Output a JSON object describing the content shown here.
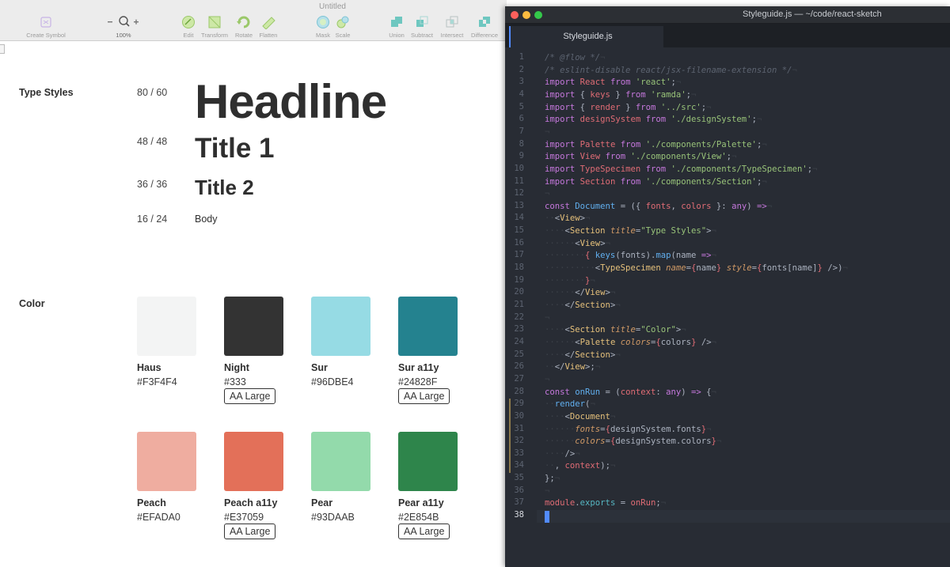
{
  "sketch": {
    "window_title": "Untitled",
    "toolbar": [
      {
        "label": "Create Symbol",
        "icon": "create-symbol-icon"
      },
      {
        "label": "100%",
        "icon": "zoom-icon"
      },
      {
        "label": "Edit",
        "icon": "edit-icon"
      },
      {
        "label": "Transform",
        "icon": "transform-icon"
      },
      {
        "label": "Rotate",
        "icon": "rotate-icon"
      },
      {
        "label": "Flatten",
        "icon": "flatten-icon"
      },
      {
        "label": "Mask",
        "icon": "mask-icon"
      },
      {
        "label": "Scale",
        "icon": "scale-icon"
      },
      {
        "label": "Union",
        "icon": "union-icon"
      },
      {
        "label": "Subtract",
        "icon": "subtract-icon"
      },
      {
        "label": "Intersect",
        "icon": "intersect-icon"
      },
      {
        "label": "Difference",
        "icon": "difference-icon"
      }
    ],
    "type_styles": {
      "label": "Type Styles",
      "items": [
        {
          "size": "80 / 60",
          "sample": "Headline"
        },
        {
          "size": "48 / 48",
          "sample": "Title 1"
        },
        {
          "size": "36 / 36",
          "sample": "Title 2"
        },
        {
          "size": "16 / 24",
          "sample": "Body"
        }
      ]
    },
    "color": {
      "label": "Color",
      "swatches": [
        {
          "name": "Haus",
          "hex": "#F3F4F4",
          "color": "#F3F4F4",
          "badge": ""
        },
        {
          "name": "Night",
          "hex": "#333",
          "color": "#333333",
          "badge": "AA Large"
        },
        {
          "name": "Sur",
          "hex": "#96DBE4",
          "color": "#96DBE4",
          "badge": ""
        },
        {
          "name": "Sur a11y",
          "hex": "#24828F",
          "color": "#24828F",
          "badge": "AA Large"
        },
        {
          "name": "Peach",
          "hex": "#EFADA0",
          "color": "#EFADA0",
          "badge": ""
        },
        {
          "name": "Peach a11y",
          "hex": "#E37059",
          "color": "#E37059",
          "badge": "AA Large"
        },
        {
          "name": "Pear",
          "hex": "#93DAAB",
          "color": "#93DAAB",
          "badge": ""
        },
        {
          "name": "Pear a11y",
          "hex": "#2E854B",
          "color": "#2E854B",
          "badge": "AA Large"
        }
      ]
    }
  },
  "editor": {
    "window_title": "Styleguide.js — ~/code/react-sketch",
    "tab_label": "Styleguide.js",
    "line_numbers": [
      "1",
      "2",
      "3",
      "4",
      "5",
      "6",
      "7",
      "8",
      "9",
      "10",
      "11",
      "12",
      "13",
      "14",
      "15",
      "16",
      "17",
      "18",
      "19",
      "20",
      "21",
      "22",
      "23",
      "24",
      "25",
      "26",
      "27",
      "28",
      "29",
      "30",
      "31",
      "32",
      "33",
      "34",
      "35",
      "36",
      "37",
      "38"
    ],
    "active_line": 38,
    "code": [
      [
        [
          "/* @flow */",
          "c"
        ],
        [
          "¬",
          "ws"
        ]
      ],
      [
        [
          "/* eslint-disable react/jsx-filename-extension */",
          "c"
        ],
        [
          "¬",
          "ws"
        ]
      ],
      [
        [
          "import",
          "k"
        ],
        [
          " ",
          ""
        ],
        [
          "React",
          "v"
        ],
        [
          " ",
          ""
        ],
        [
          "from",
          "k"
        ],
        [
          " ",
          ""
        ],
        [
          "'react'",
          "s"
        ],
        [
          ";",
          "p"
        ],
        [
          "¬",
          "ws"
        ]
      ],
      [
        [
          "import",
          "k"
        ],
        [
          " { ",
          "p"
        ],
        [
          "keys",
          "v"
        ],
        [
          " } ",
          "p"
        ],
        [
          "from",
          "k"
        ],
        [
          " ",
          ""
        ],
        [
          "'ramda'",
          "s"
        ],
        [
          ";",
          "p"
        ],
        [
          "¬",
          "ws"
        ]
      ],
      [
        [
          "import",
          "k"
        ],
        [
          " { ",
          "p"
        ],
        [
          "render",
          "v"
        ],
        [
          " } ",
          "p"
        ],
        [
          "from",
          "k"
        ],
        [
          " ",
          ""
        ],
        [
          "'../src'",
          "s"
        ],
        [
          ";",
          "p"
        ],
        [
          "¬",
          "ws"
        ]
      ],
      [
        [
          "import",
          "k"
        ],
        [
          " ",
          ""
        ],
        [
          "designSystem",
          "v"
        ],
        [
          " ",
          ""
        ],
        [
          "from",
          "k"
        ],
        [
          " ",
          ""
        ],
        [
          "'./designSystem'",
          "s"
        ],
        [
          ";",
          "p"
        ],
        [
          "¬",
          "ws"
        ]
      ],
      [
        [
          "¬",
          "ws"
        ]
      ],
      [
        [
          "import",
          "k"
        ],
        [
          " ",
          ""
        ],
        [
          "Palette",
          "v"
        ],
        [
          " ",
          ""
        ],
        [
          "from",
          "k"
        ],
        [
          " ",
          ""
        ],
        [
          "'./components/Palette'",
          "s"
        ],
        [
          ";",
          "p"
        ],
        [
          "¬",
          "ws"
        ]
      ],
      [
        [
          "import",
          "k"
        ],
        [
          " ",
          ""
        ],
        [
          "View",
          "v"
        ],
        [
          " ",
          ""
        ],
        [
          "from",
          "k"
        ],
        [
          " ",
          ""
        ],
        [
          "'./components/View'",
          "s"
        ],
        [
          ";",
          "p"
        ],
        [
          "¬",
          "ws"
        ]
      ],
      [
        [
          "import",
          "k"
        ],
        [
          " ",
          ""
        ],
        [
          "TypeSpecimen",
          "v"
        ],
        [
          " ",
          ""
        ],
        [
          "from",
          "k"
        ],
        [
          " ",
          ""
        ],
        [
          "'./components/TypeSpecimen'",
          "s"
        ],
        [
          ";",
          "p"
        ],
        [
          "¬",
          "ws"
        ]
      ],
      [
        [
          "import",
          "k"
        ],
        [
          " ",
          ""
        ],
        [
          "Section",
          "v"
        ],
        [
          " ",
          ""
        ],
        [
          "from",
          "k"
        ],
        [
          " ",
          ""
        ],
        [
          "'./components/Section'",
          "s"
        ],
        [
          ";",
          "p"
        ],
        [
          "¬",
          "ws"
        ]
      ],
      [
        [
          "¬",
          "ws"
        ]
      ],
      [
        [
          "const",
          "k"
        ],
        [
          " ",
          ""
        ],
        [
          "Document",
          "f"
        ],
        [
          " = (",
          "p"
        ],
        [
          "{ ",
          "p"
        ],
        [
          "fonts",
          "v"
        ],
        [
          ", ",
          "p"
        ],
        [
          "colors",
          "v"
        ],
        [
          " }",
          "p"
        ],
        [
          ": ",
          "p"
        ],
        [
          "any",
          "k"
        ],
        [
          ") ",
          "p"
        ],
        [
          "=>",
          "k"
        ],
        [
          "¬",
          "ws"
        ]
      ],
      [
        [
          "··",
          "ws"
        ],
        [
          "<",
          "p"
        ],
        [
          "View",
          "tag"
        ],
        [
          ">",
          "p"
        ],
        [
          "¬",
          "ws"
        ]
      ],
      [
        [
          "····",
          "ws"
        ],
        [
          "<",
          "p"
        ],
        [
          "Section",
          "tag"
        ],
        [
          " ",
          ""
        ],
        [
          "title",
          "a"
        ],
        [
          "=",
          "p"
        ],
        [
          "\"Type Styles\"",
          "s"
        ],
        [
          ">",
          "p"
        ],
        [
          "¬",
          "ws"
        ]
      ],
      [
        [
          "······",
          "ws"
        ],
        [
          "<",
          "p"
        ],
        [
          "View",
          "tag"
        ],
        [
          ">",
          "p"
        ],
        [
          "¬",
          "ws"
        ]
      ],
      [
        [
          "········",
          "ws"
        ],
        [
          "{ ",
          "v"
        ],
        [
          "keys",
          "f"
        ],
        [
          "(fonts).",
          "p"
        ],
        [
          "map",
          "f"
        ],
        [
          "(name ",
          "p"
        ],
        [
          "=>",
          "k"
        ],
        [
          "¬",
          "ws"
        ]
      ],
      [
        [
          "··········",
          "ws"
        ],
        [
          "<",
          "p"
        ],
        [
          "TypeSpecimen",
          "tag"
        ],
        [
          " ",
          ""
        ],
        [
          "name",
          "a"
        ],
        [
          "=",
          "p"
        ],
        [
          "{",
          "v"
        ],
        [
          "name",
          "p"
        ],
        [
          "}",
          "v"
        ],
        [
          " ",
          ""
        ],
        [
          "style",
          "a"
        ],
        [
          "=",
          "p"
        ],
        [
          "{",
          "v"
        ],
        [
          "fonts[name]",
          "p"
        ],
        [
          "}",
          "v"
        ],
        [
          " />)",
          "p"
        ],
        [
          "¬",
          "ws"
        ]
      ],
      [
        [
          "········",
          "ws"
        ],
        [
          "}",
          "v"
        ],
        [
          "¬",
          "ws"
        ]
      ],
      [
        [
          "······",
          "ws"
        ],
        [
          "</",
          "p"
        ],
        [
          "View",
          "tag"
        ],
        [
          ">",
          "p"
        ],
        [
          "¬",
          "ws"
        ]
      ],
      [
        [
          "····",
          "ws"
        ],
        [
          "</",
          "p"
        ],
        [
          "Section",
          "tag"
        ],
        [
          ">",
          "p"
        ],
        [
          "¬",
          "ws"
        ]
      ],
      [
        [
          "¬",
          "ws"
        ]
      ],
      [
        [
          "····",
          "ws"
        ],
        [
          "<",
          "p"
        ],
        [
          "Section",
          "tag"
        ],
        [
          " ",
          ""
        ],
        [
          "title",
          "a"
        ],
        [
          "=",
          "p"
        ],
        [
          "\"Color\"",
          "s"
        ],
        [
          ">",
          "p"
        ],
        [
          "¬",
          "ws"
        ]
      ],
      [
        [
          "······",
          "ws"
        ],
        [
          "<",
          "p"
        ],
        [
          "Palette",
          "tag"
        ],
        [
          " ",
          ""
        ],
        [
          "colors",
          "a"
        ],
        [
          "=",
          "p"
        ],
        [
          "{",
          "v"
        ],
        [
          "colors",
          "p"
        ],
        [
          "}",
          "v"
        ],
        [
          " />",
          "p"
        ],
        [
          "¬",
          "ws"
        ]
      ],
      [
        [
          "····",
          "ws"
        ],
        [
          "</",
          "p"
        ],
        [
          "Section",
          "tag"
        ],
        [
          ">",
          "p"
        ],
        [
          "¬",
          "ws"
        ]
      ],
      [
        [
          "··",
          "ws"
        ],
        [
          "</",
          "p"
        ],
        [
          "View",
          "tag"
        ],
        [
          ">;",
          "p"
        ],
        [
          "¬",
          "ws"
        ]
      ],
      [
        [
          "¬",
          "ws"
        ]
      ],
      [
        [
          "const",
          "k"
        ],
        [
          " ",
          ""
        ],
        [
          "onRun",
          "f"
        ],
        [
          " = (",
          "p"
        ],
        [
          "context",
          "v"
        ],
        [
          ": ",
          "p"
        ],
        [
          "any",
          "k"
        ],
        [
          ") ",
          "p"
        ],
        [
          "=>",
          "k"
        ],
        [
          " {",
          "p"
        ],
        [
          "¬",
          "ws"
        ]
      ],
      [
        [
          "··",
          "ws"
        ],
        [
          "render",
          "f"
        ],
        [
          "(",
          "p"
        ],
        [
          "¬",
          "ws"
        ]
      ],
      [
        [
          "····",
          "ws"
        ],
        [
          "<",
          "p"
        ],
        [
          "Document",
          "tag"
        ],
        [
          "¬",
          "ws"
        ]
      ],
      [
        [
          "······",
          "ws"
        ],
        [
          "fonts",
          "a"
        ],
        [
          "=",
          "p"
        ],
        [
          "{",
          "v"
        ],
        [
          "designSystem.fonts",
          "p"
        ],
        [
          "}",
          "v"
        ],
        [
          "¬",
          "ws"
        ]
      ],
      [
        [
          "······",
          "ws"
        ],
        [
          "colors",
          "a"
        ],
        [
          "=",
          "p"
        ],
        [
          "{",
          "v"
        ],
        [
          "designSystem.colors",
          "p"
        ],
        [
          "}",
          "v"
        ],
        [
          "¬",
          "ws"
        ]
      ],
      [
        [
          "····",
          "ws"
        ],
        [
          "/>",
          "p"
        ],
        [
          "¬",
          "ws"
        ]
      ],
      [
        [
          "··",
          "ws"
        ],
        [
          ", ",
          "p"
        ],
        [
          "context",
          "v"
        ],
        [
          ");",
          "p"
        ],
        [
          "¬",
          "ws"
        ]
      ],
      [
        [
          "};",
          "p"
        ],
        [
          "¬",
          "ws"
        ]
      ],
      [
        [
          "¬",
          "ws"
        ]
      ],
      [
        [
          "module",
          "v"
        ],
        [
          ".",
          "p"
        ],
        [
          "exports",
          "o"
        ],
        [
          " = ",
          "p"
        ],
        [
          "onRun",
          "v"
        ],
        [
          ";",
          "p"
        ],
        [
          "¬",
          "ws"
        ]
      ],
      []
    ]
  }
}
